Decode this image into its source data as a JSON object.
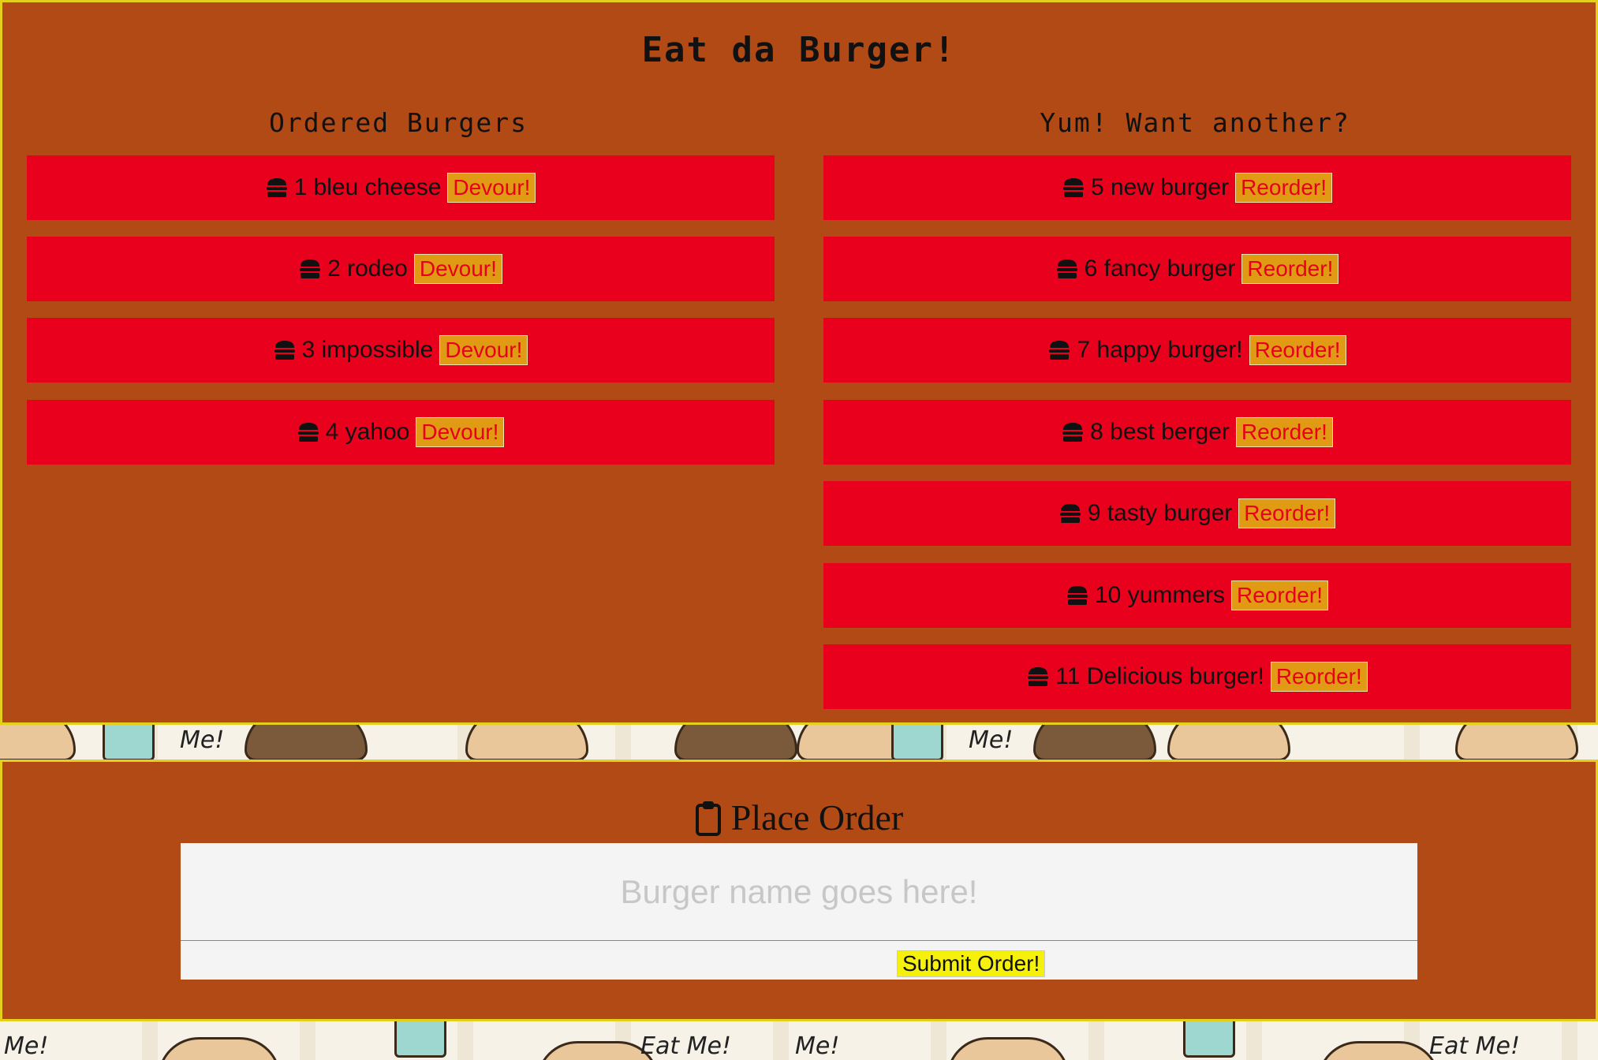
{
  "app": {
    "title": "Eat da Burger!"
  },
  "ordered": {
    "heading": "Ordered Burgers",
    "button_label": "Devour!",
    "items": [
      {
        "text": "1 bleu cheese"
      },
      {
        "text": "2 rodeo"
      },
      {
        "text": "3 impossible"
      },
      {
        "text": "4 yahoo"
      }
    ]
  },
  "devoured": {
    "heading": "Yum! Want another?",
    "button_label": "Reorder!",
    "items": [
      {
        "text": "5 new burger"
      },
      {
        "text": "6 fancy burger"
      },
      {
        "text": "7 happy burger!"
      },
      {
        "text": "8 best berger"
      },
      {
        "text": "9 tasty burger"
      },
      {
        "text": "10 yummers"
      },
      {
        "text": "11 Delicious burger!"
      }
    ]
  },
  "order_form": {
    "title": "Place Order",
    "placeholder": "Burger name goes here!",
    "value": "",
    "submit_label": "Submit Order!"
  },
  "wallpaper": {
    "text": "Eat Me!",
    "short": "Me!"
  },
  "colors": {
    "panel_bg": "#b24a15",
    "panel_border": "#e3cf1c",
    "row_bg": "#e8001c",
    "row_button_bg": "#e09a13",
    "submit_bg": "#f5f10c"
  },
  "icons": {
    "row_icon": "hamburger-icon",
    "form_icon": "clipboard-icon"
  }
}
